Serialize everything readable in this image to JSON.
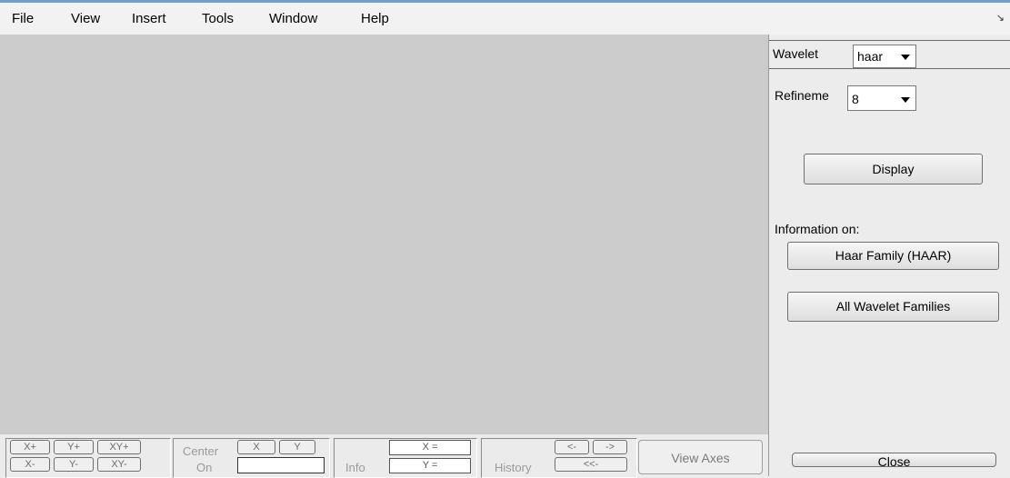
{
  "menu": {
    "items": [
      "File",
      "View",
      "Insert",
      "Tools",
      "Window",
      "Help"
    ],
    "corner_icon": "dock-arrow-icon"
  },
  "toolbar": {
    "zoom": [
      "X+",
      "Y+",
      "XY+",
      "X-",
      "Y-",
      "XY-"
    ],
    "center_label_1": "Center",
    "center_label_2": "On",
    "center_x": "X",
    "center_y": "Y",
    "info_label": "Info",
    "info_x": "X =",
    "info_y": "Y =",
    "history_label": "History",
    "history_back": "<-",
    "history_forward": "->",
    "history_first": "<<-",
    "view_axes": "View Axes"
  },
  "side": {
    "wavelet_label": "Wavelet",
    "wavelet_value": "haar",
    "refine_label": "Refineme",
    "refine_value": "8",
    "display_button": "Display",
    "info_on_label": "Information on:",
    "family_button": "Haar Family (HAAR)",
    "all_button": "All Wavelet Families",
    "close_button": "Close"
  }
}
